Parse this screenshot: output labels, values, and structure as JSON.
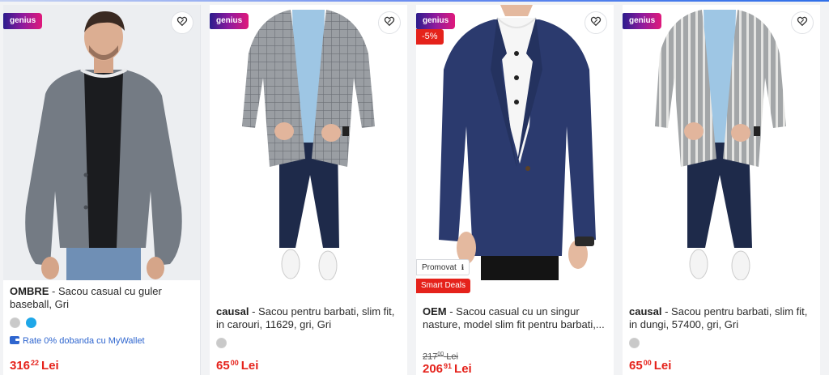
{
  "colors": {
    "brand_red": "#e5221b",
    "link_blue": "#2f66cf",
    "genius_gradient": [
      "#2b1c8c",
      "#e0197b"
    ]
  },
  "products": [
    {
      "badge": "genius",
      "brand": "OMBRE",
      "name": " - Sacou casual cu guler baseball, Gri",
      "swatches": [
        "#c9c9c9",
        "#1fa7e8"
      ],
      "installment": "Rate 0% dobanda cu MyWallet",
      "price_int": "316",
      "price_dec": "22",
      "currency": "Lei",
      "favorite_icon": "heart-outline-icon"
    },
    {
      "badge": "genius",
      "brand": "causal",
      "name": " - Sacou pentru barbati, slim fit, in carouri, 11629, gri, Gri",
      "swatches": [
        "#c9c9c9"
      ],
      "price_int": "65",
      "price_dec": "00",
      "currency": "Lei",
      "favorite_icon": "heart-outline-icon"
    },
    {
      "badge": "genius",
      "discount": "-5%",
      "promo_label": "Promovat",
      "promo_info_icon": "info-icon",
      "smart_label": "Smart Deals",
      "brand": "OEM",
      "name": " - Sacou casual cu un singur nasture, model slim fit pentru barbati,...",
      "old_price_int": "217",
      "old_price_dec": "00",
      "old_currency": "Lei",
      "price_int": "206",
      "price_dec": "91",
      "currency": "Lei",
      "favorite_icon": "heart-outline-icon"
    },
    {
      "badge": "genius",
      "brand": "causal",
      "name": " - Sacou pentru barbati, slim fit, in dungi, 57400, gri, Gri",
      "swatches": [
        "#c9c9c9"
      ],
      "price_int": "65",
      "price_dec": "00",
      "currency": "Lei",
      "favorite_icon": "heart-outline-icon"
    }
  ]
}
